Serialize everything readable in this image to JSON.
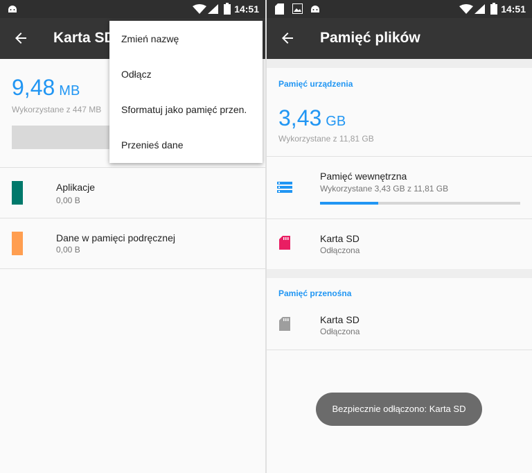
{
  "status": {
    "time": "14:51"
  },
  "left": {
    "title": "Karta SD",
    "used_value": "9,48",
    "used_unit": "MB",
    "used_caption": "Wykorzystane z 447 MB",
    "items": [
      {
        "label": "Aplikacje",
        "value": "0,00 B",
        "color": "#00796b"
      },
      {
        "label": "Dane w pamięci podręcznej",
        "value": "0,00 B",
        "color": "#ff9e50"
      }
    ],
    "menu": [
      "Zmień nazwę",
      "Odłącz",
      "Sformatuj jako pamięć przen.",
      "Przenieś dane"
    ]
  },
  "right": {
    "title": "Pamięć plików",
    "device_header": "Pamięć urządzenia",
    "used_value": "3,43",
    "used_unit": "GB",
    "used_caption": "Wykorzystane z 11,81 GB",
    "internal": {
      "label": "Pamięć wewnętrzna",
      "sub": "Wykorzystane 3,43 GB z 11,81 GB",
      "progress": 0.29,
      "icon": "storage-icon",
      "color": "#2196f3"
    },
    "sd_internal": {
      "label": "Karta SD",
      "sub": "Odłączona",
      "icon": "sd-card-icon",
      "color": "#e91e63"
    },
    "portable_header": "Pamięć przenośna",
    "sd_portable": {
      "label": "Karta SD",
      "sub": "Odłączona",
      "icon": "sd-card-icon",
      "color": "#9e9e9e"
    },
    "toast": "Bezpiecznie odłączono: Karta SD"
  }
}
